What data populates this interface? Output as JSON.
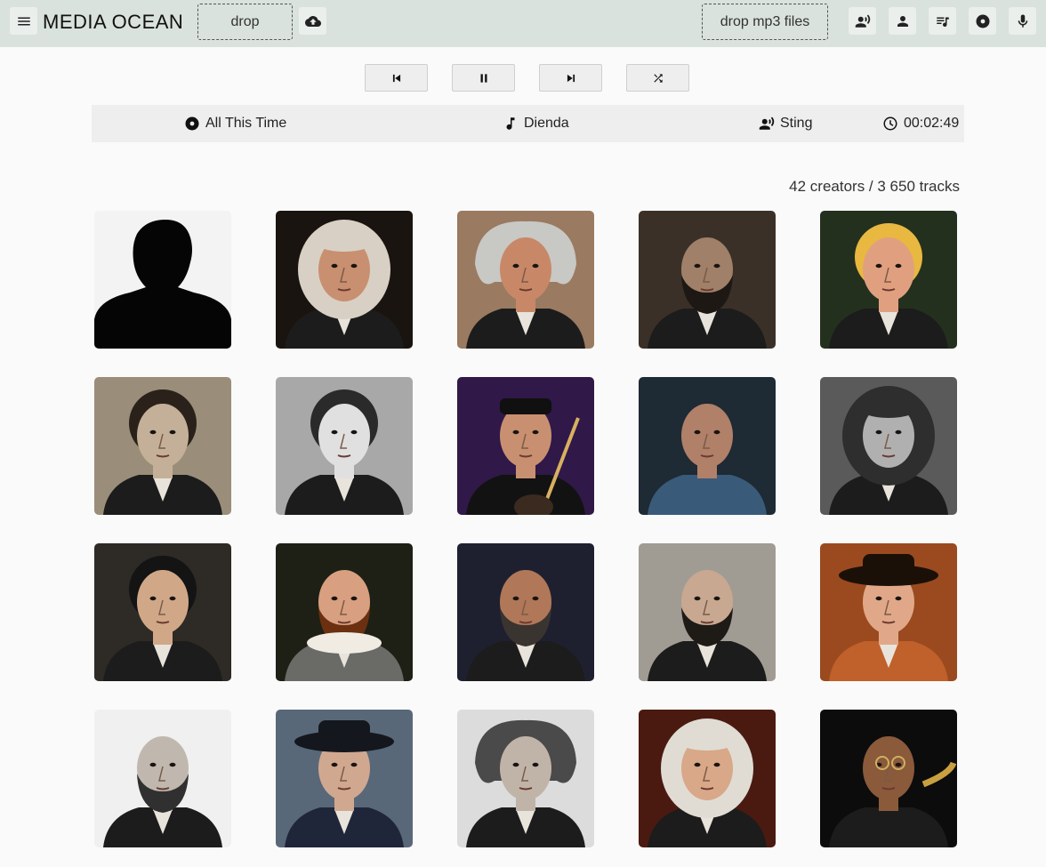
{
  "app": {
    "title": "MEDIA OCEAN"
  },
  "header": {
    "drop_label": "drop",
    "drop_mp3_label": "drop mp3 files",
    "icons": [
      "menu-icon",
      "cloud-upload-icon",
      "artist-voice-icon",
      "person-icon",
      "playlist-icon",
      "album-icon",
      "microphone-icon"
    ]
  },
  "controls": {
    "icons": [
      "skip-previous-icon",
      "pause-icon",
      "skip-next-icon",
      "shuffle-icon"
    ]
  },
  "now_playing": {
    "album": "All This Time",
    "track": "Dienda",
    "artist": "Sting",
    "time": "00:02:49"
  },
  "stats": {
    "text": "42 creators / 3 650 tracks"
  },
  "creators": [
    {
      "bg": "#f3f3f3",
      "fg": "#050505",
      "hair": "#050505",
      "type": "placeholder"
    },
    {
      "bg": "#1a1410",
      "fg": "#c89070",
      "hair": "#d8d0c4",
      "type": "wig"
    },
    {
      "bg": "#9a7a60",
      "fg": "#c88868",
      "hair": "#c8c8c4",
      "type": "wild"
    },
    {
      "bg": "#3a3028",
      "fg": "#a08068",
      "hair": "#1e1814",
      "type": "beard"
    },
    {
      "bg": "#24301e",
      "fg": "#e0a080",
      "hair": "#e8b840",
      "type": "short"
    },
    {
      "bg": "#9a8e7a",
      "fg": "#c4b098",
      "hair": "#2a221a",
      "type": "short"
    },
    {
      "bg": "#a8a8a8",
      "fg": "#e0e0e0",
      "hair": "#2a2a2a",
      "type": "short"
    },
    {
      "bg": "#301848",
      "fg": "#c89070",
      "hair": "#101010",
      "type": "guitar"
    },
    {
      "bg": "#1e2a34",
      "fg": "#b08068",
      "hair": "#6a5a4a",
      "type": "bald"
    },
    {
      "bg": "#5a5a5a",
      "fg": "#b0b0b0",
      "hair": "#2e2e2e",
      "type": "wig"
    },
    {
      "bg": "#2e2a26",
      "fg": "#d0a888",
      "hair": "#141414",
      "type": "short"
    },
    {
      "bg": "#1e2016",
      "fg": "#d8a080",
      "hair": "#6a3010",
      "type": "ruff"
    },
    {
      "bg": "#1e2030",
      "fg": "#b07858",
      "hair": "#3a3430",
      "type": "beard"
    },
    {
      "bg": "#a09c94",
      "fg": "#c8a890",
      "hair": "#1e1a16",
      "type": "beard"
    },
    {
      "bg": "#9a4a1e",
      "fg": "#e0a888",
      "hair": "#1a1008",
      "type": "hat"
    },
    {
      "bg": "#f0f0f0",
      "fg": "#c0b8ae",
      "hair": "#303030",
      "type": "beard"
    },
    {
      "bg": "#586878",
      "fg": "#d0a890",
      "hair": "#14181e",
      "type": "hat"
    },
    {
      "bg": "#dcdcdc",
      "fg": "#c0b4a8",
      "hair": "#4a4a4a",
      "type": "wild"
    },
    {
      "bg": "#4a1a10",
      "fg": "#d8a888",
      "hair": "#e0dcd4",
      "type": "wig"
    },
    {
      "bg": "#0c0c0c",
      "fg": "#8a5a3a",
      "hair": "#d0d0d0",
      "type": "sax"
    }
  ]
}
